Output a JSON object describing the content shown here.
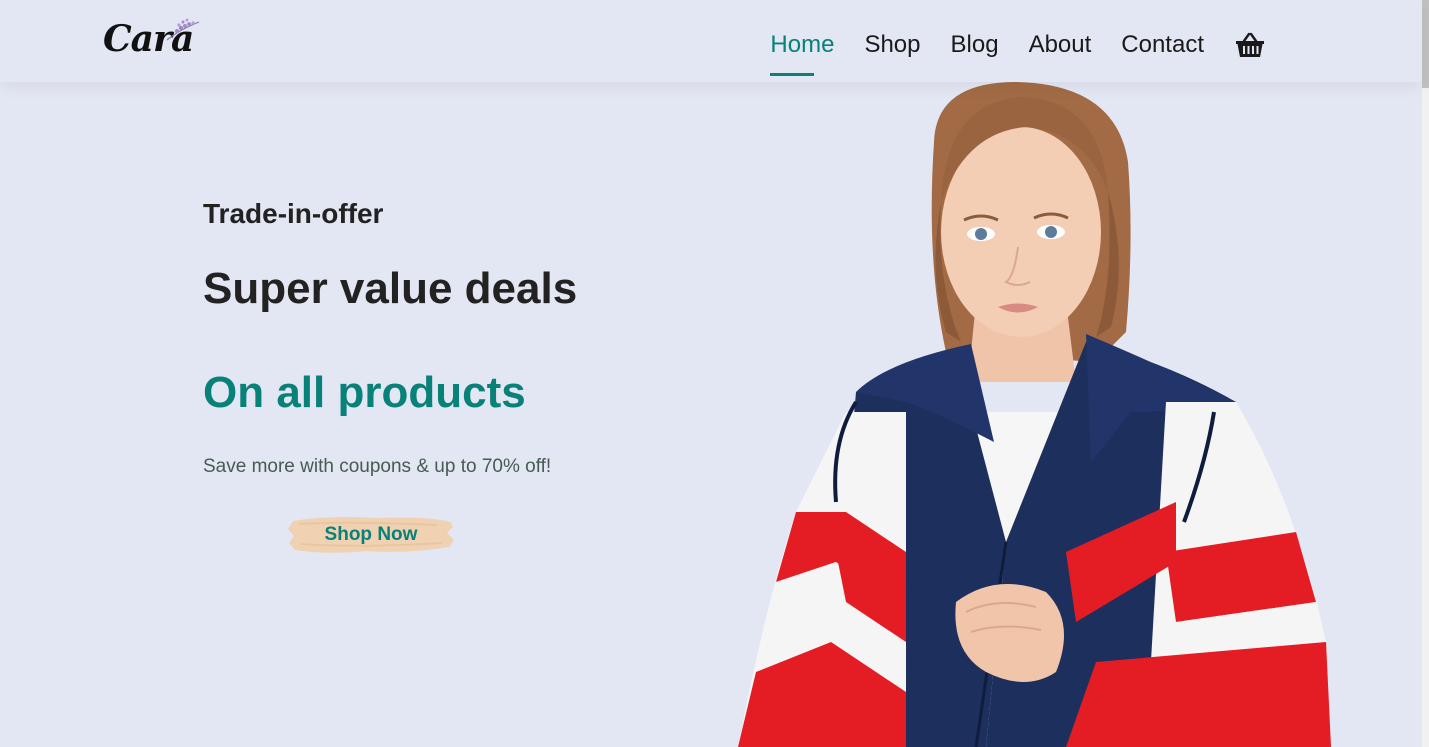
{
  "brand": {
    "logo_text": "Cara"
  },
  "nav": {
    "items": [
      {
        "label": "Home",
        "active": true
      },
      {
        "label": "Shop",
        "active": false
      },
      {
        "label": "Blog",
        "active": false
      },
      {
        "label": "About",
        "active": false
      },
      {
        "label": "Contact",
        "active": false
      }
    ],
    "cart_icon": "basket-icon"
  },
  "hero": {
    "eyebrow": "Trade-in-offer",
    "headline": "Super value deals",
    "highlight": "On all products",
    "subtext": "Save more with coupons & up to 70% off!",
    "cta_label": "Shop Now"
  },
  "colors": {
    "accent": "#088178",
    "background": "#e3e6f3",
    "text_dark": "#222222",
    "cta_bg": "#f0d2b3"
  }
}
